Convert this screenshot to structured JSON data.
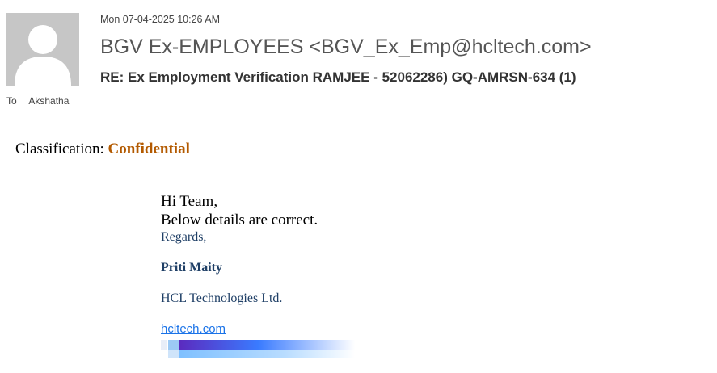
{
  "header": {
    "date": "Mon 07-04-2025 10:26 AM",
    "sender": "BGV Ex-EMPLOYEES <BGV_Ex_Emp@hcltech.com>",
    "subject": "RE: Ex Employment Verification RAMJEE -  52062286) GQ-AMRSN-634 (1)",
    "to_label": "To",
    "to_name": "Akshatha",
    "avatar_icon": "person-placeholder-icon"
  },
  "body": {
    "classification_label": "Classification:",
    "classification_value": "Confidential",
    "greeting": "Hi Team,",
    "line1": "Below details are correct.",
    "regards": "Regards,",
    "signature_name": "Priti Maity",
    "company": "HCL Technologies Ltd.",
    "link": "hcltech.com"
  },
  "colors": {
    "classification": "#b35a00",
    "signature_text": "#1f3f66",
    "link": "#1a73e8",
    "brand_gradient": [
      "#5b2bbf",
      "#3a7bff",
      "#b8dcff"
    ]
  }
}
